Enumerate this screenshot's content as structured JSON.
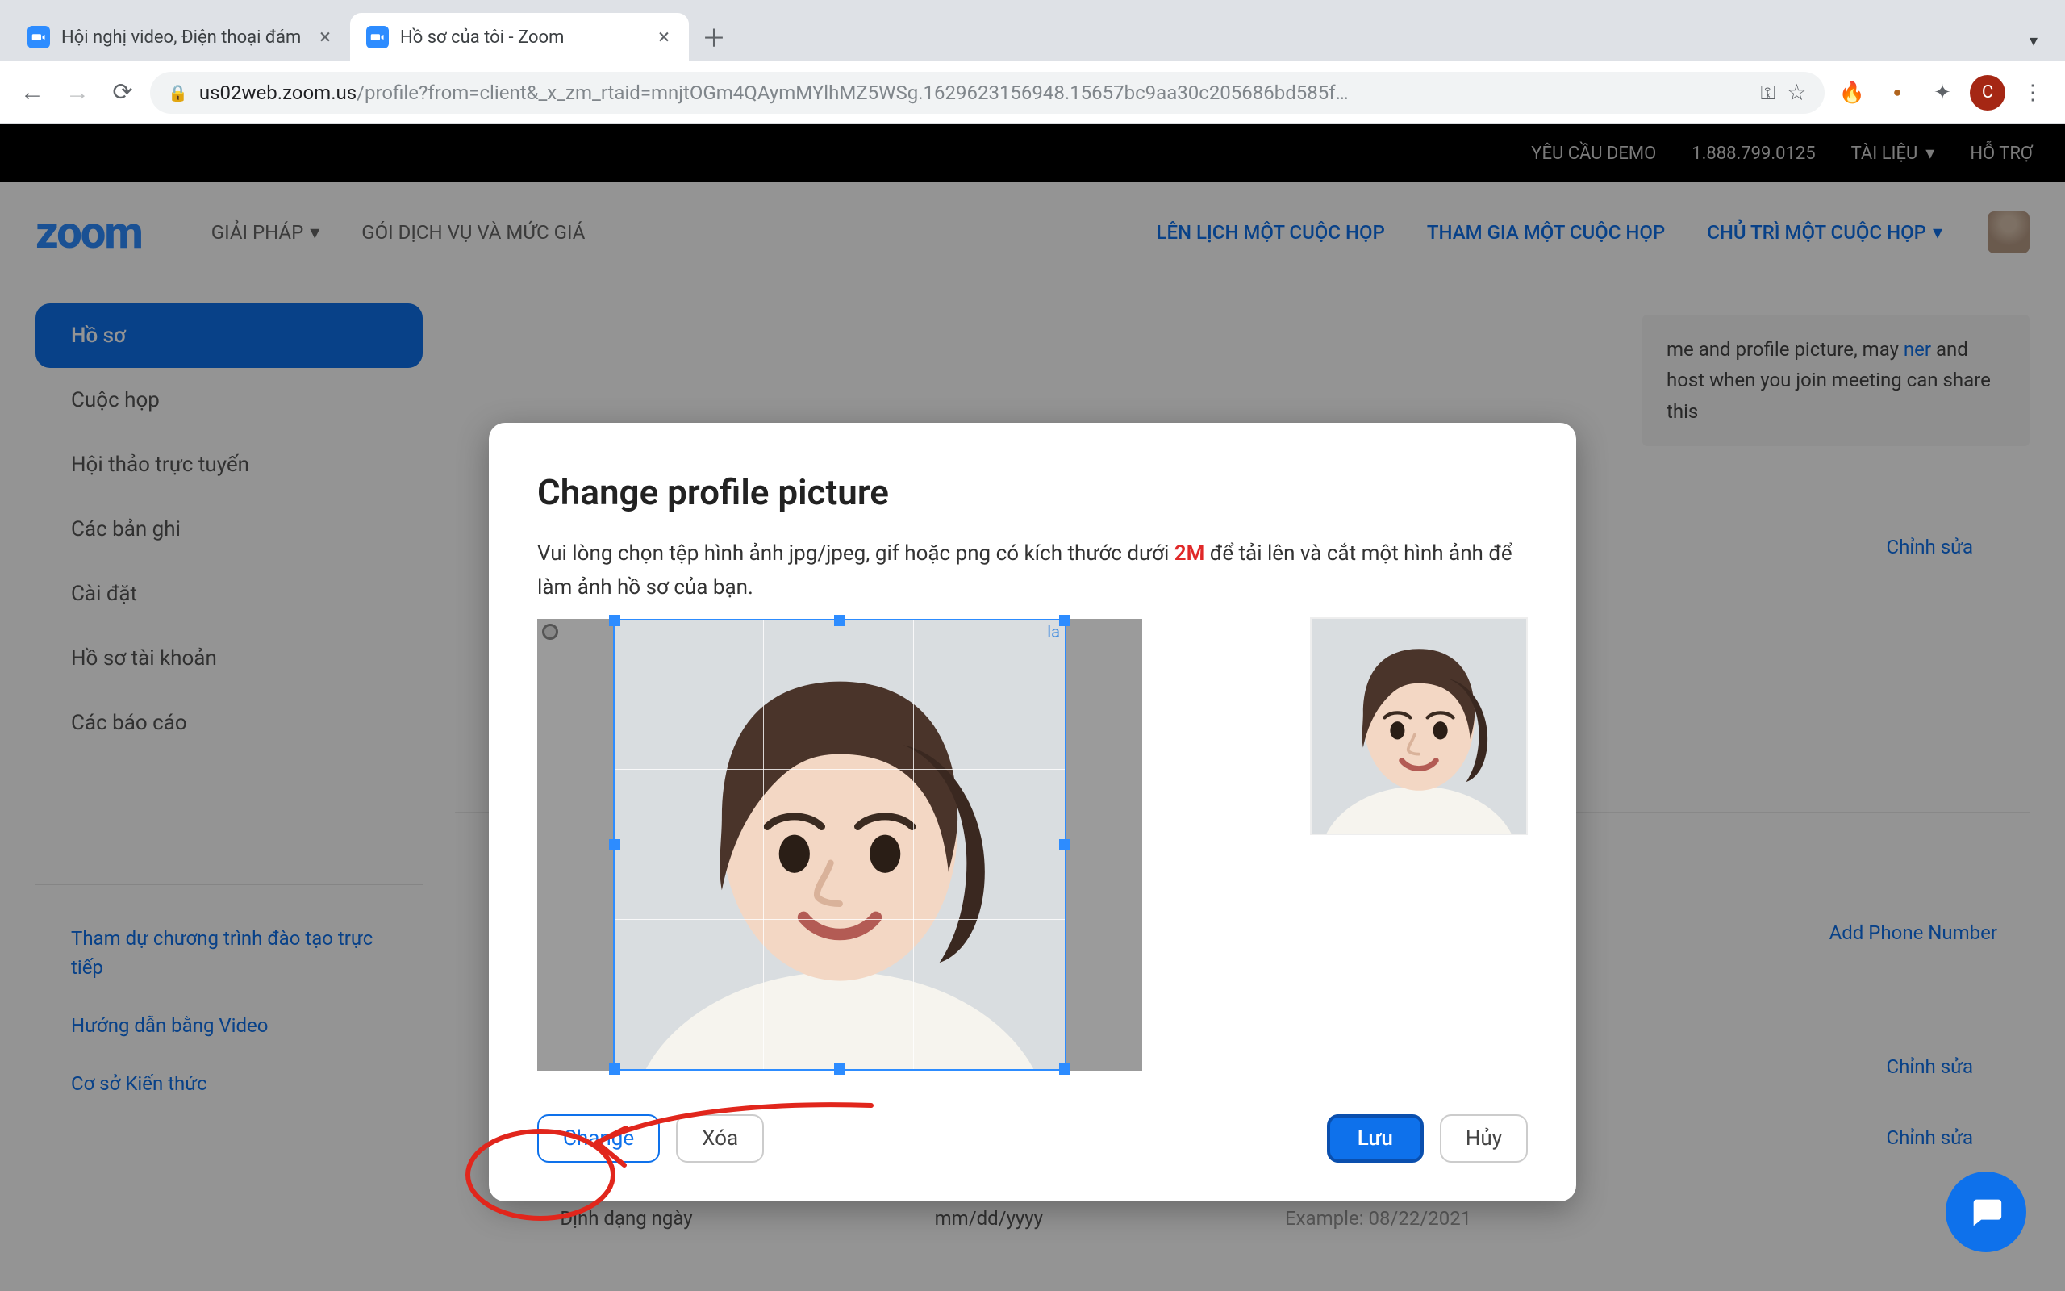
{
  "browser": {
    "tabs": [
      {
        "title": "Hội nghị video, Điện thoại đám",
        "active": false
      },
      {
        "title": "Hồ sơ của tôi - Zoom",
        "active": true
      }
    ],
    "url_host": "us02web.zoom.us",
    "url_path": "/profile?from=client&_x_zm_rtaid=mnjtOGm4QAymMYlhMZ5WSg.1629623156948.15657bc9aa30c205686bd585f…",
    "avatar_letter": "C"
  },
  "topbar": {
    "demo": "YÊU CẦU DEMO",
    "phone": "1.888.799.0125",
    "docs": "TÀI LIỆU",
    "support": "HỖ TRỢ"
  },
  "nav": {
    "logo": "zoom",
    "solutions": "GIẢI PHÁP",
    "plans": "GÓI DỊCH VỤ VÀ MỨC GIÁ",
    "schedule": "LÊN LỊCH MỘT CUỘC HỌP",
    "join": "THAM GIA MỘT CUỘC HỌP",
    "host": "CHỦ TRÌ MỘT CUỘC HỌP"
  },
  "sidebar": {
    "items": [
      "Hồ sơ",
      "Cuộc họp",
      "Hội thảo trực tuyến",
      "Các bản ghi",
      "Cài đặt",
      "Hồ sơ tài khoản",
      "Các báo cáo"
    ],
    "links": [
      "Tham dự chương trình đào tạo trực tiếp",
      "Hướng dẫn bằng Video",
      "Cơ sở Kiến thức"
    ]
  },
  "content": {
    "info_text_pre": "me and profile picture, may ",
    "info_link": "ner",
    "info_text_post": " and host when you join meeting can share this",
    "edit": "Chỉnh sửa",
    "add_phone": "Add Phone Number",
    "date_label": "Định dạng ngày",
    "date_value": "mm/dd/yyyy",
    "date_example": "Example: 08/22/2021"
  },
  "modal": {
    "title": "Change profile picture",
    "desc_pre": "Vui lòng chọn tệp hình ảnh jpg/jpeg, gif hoặc png có kích thước dưới ",
    "desc_limit": "2M",
    "desc_post": " để tải lên và cắt một hình ảnh để làm ảnh hồ sơ của bạn.",
    "crop_label": "la",
    "change": "Change",
    "delete": "Xóa",
    "save": "Lưu",
    "cancel": "Hủy"
  }
}
